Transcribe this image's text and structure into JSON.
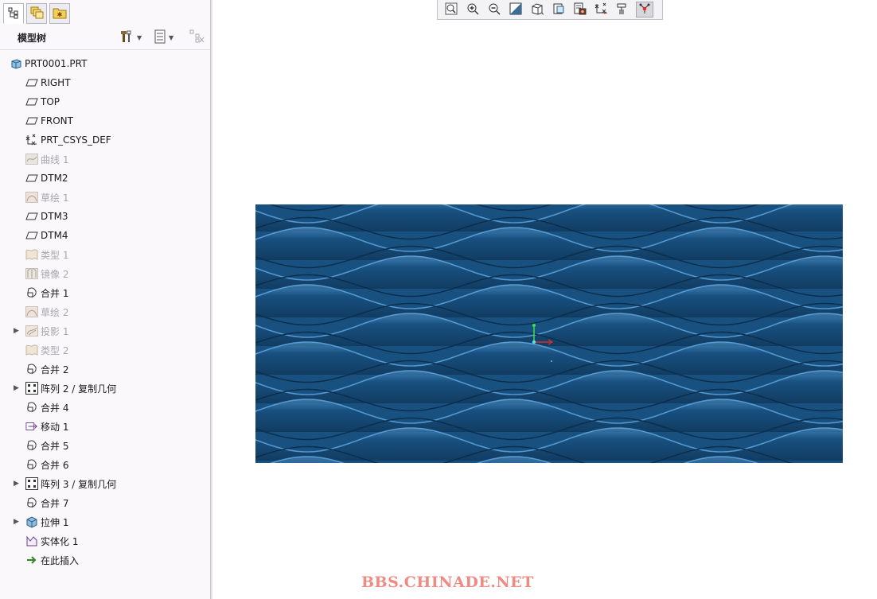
{
  "tabs": [
    {
      "icon": "model-tree-icon",
      "active": true
    },
    {
      "icon": "layers-icon",
      "active": false
    },
    {
      "icon": "folder-favorite-icon",
      "active": false
    }
  ],
  "panel": {
    "title": "模型树"
  },
  "tree": [
    {
      "label": "PRT0001.PRT",
      "icon": "part-icon",
      "dim": false,
      "expander": false,
      "indent": 0
    },
    {
      "label": "RIGHT",
      "icon": "datum-plane-icon",
      "dim": false,
      "expander": false,
      "indent": 1
    },
    {
      "label": "TOP",
      "icon": "datum-plane-icon",
      "dim": false,
      "expander": false,
      "indent": 1
    },
    {
      "label": "FRONT",
      "icon": "datum-plane-icon",
      "dim": false,
      "expander": false,
      "indent": 1
    },
    {
      "label": "PRT_CSYS_DEF",
      "icon": "csys-icon",
      "dim": false,
      "expander": false,
      "indent": 1
    },
    {
      "label": "曲线 1",
      "icon": "curve-icon",
      "dim": true,
      "expander": false,
      "indent": 1
    },
    {
      "label": "DTM2",
      "icon": "datum-plane-icon",
      "dim": false,
      "expander": false,
      "indent": 1
    },
    {
      "label": "草绘 1",
      "icon": "sketch-icon",
      "dim": true,
      "expander": false,
      "indent": 1
    },
    {
      "label": "DTM3",
      "icon": "datum-plane-icon",
      "dim": false,
      "expander": false,
      "indent": 1
    },
    {
      "label": "DTM4",
      "icon": "datum-plane-icon",
      "dim": false,
      "expander": false,
      "indent": 1
    },
    {
      "label": "类型 1",
      "icon": "style-icon",
      "dim": true,
      "expander": false,
      "indent": 1
    },
    {
      "label": "镜像 2",
      "icon": "mirror-icon",
      "dim": true,
      "expander": false,
      "indent": 1
    },
    {
      "label": "合并 1",
      "icon": "merge-icon",
      "dim": false,
      "expander": false,
      "indent": 1
    },
    {
      "label": "草绘 2",
      "icon": "sketch-icon",
      "dim": true,
      "expander": false,
      "indent": 1
    },
    {
      "label": "投影 1",
      "icon": "project-icon",
      "dim": true,
      "expander": true,
      "indent": 1
    },
    {
      "label": "类型 2",
      "icon": "style-icon",
      "dim": true,
      "expander": false,
      "indent": 1
    },
    {
      "label": "合并 2",
      "icon": "merge-icon",
      "dim": false,
      "expander": false,
      "indent": 1
    },
    {
      "label": "阵列 2 / 复制几何",
      "icon": "pattern-icon",
      "dim": false,
      "expander": true,
      "indent": 1
    },
    {
      "label": "合并 4",
      "icon": "merge-icon",
      "dim": false,
      "expander": false,
      "indent": 1
    },
    {
      "label": "移动 1",
      "icon": "move-icon",
      "dim": false,
      "expander": false,
      "indent": 1
    },
    {
      "label": "合并 5",
      "icon": "merge-icon",
      "dim": false,
      "expander": false,
      "indent": 1
    },
    {
      "label": "合并 6",
      "icon": "merge-icon",
      "dim": false,
      "expander": false,
      "indent": 1
    },
    {
      "label": "阵列 3 / 复制几何",
      "icon": "pattern-icon",
      "dim": false,
      "expander": true,
      "indent": 1
    },
    {
      "label": "合并 7",
      "icon": "merge-icon",
      "dim": false,
      "expander": false,
      "indent": 1
    },
    {
      "label": "拉伸 1",
      "icon": "extrude-icon",
      "dim": false,
      "expander": true,
      "indent": 1
    },
    {
      "label": "实体化 1",
      "icon": "solidify-icon",
      "dim": false,
      "expander": false,
      "indent": 1
    },
    {
      "label": "在此插入",
      "icon": "insert-here-icon",
      "dim": false,
      "expander": false,
      "indent": 1
    }
  ],
  "toolbar": [
    {
      "icon": "refit-icon",
      "pressed": false
    },
    {
      "icon": "zoom-in-icon",
      "pressed": false
    },
    {
      "icon": "zoom-out-icon",
      "pressed": false
    },
    {
      "icon": "repaint-icon",
      "pressed": false
    },
    {
      "icon": "display-style-icon",
      "pressed": false
    },
    {
      "icon": "saved-orientations-icon",
      "pressed": false
    },
    {
      "icon": "view-manager-icon",
      "pressed": false
    },
    {
      "icon": "datum-display-icon",
      "pressed": false
    },
    {
      "icon": "annotation-display-icon",
      "pressed": false
    },
    {
      "icon": "spin-center-icon",
      "pressed": true
    }
  ],
  "watermark": "BBS.CHINADE.NET",
  "colors": {
    "surface": "#18507f",
    "highlight": "#5fa6df",
    "shadow": "#0b2c4a",
    "watermark": "#ef8b82"
  }
}
